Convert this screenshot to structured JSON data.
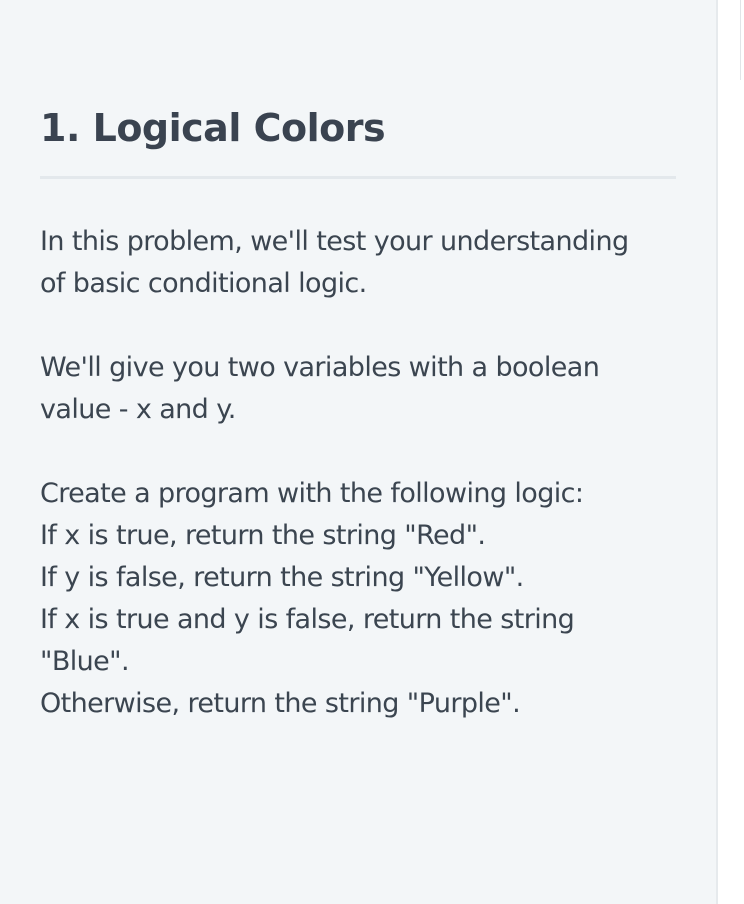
{
  "problem": {
    "title": "1. Logical Colors",
    "paragraph1": [
      "In this problem, we'll test your understanding",
      "of basic conditional logic."
    ],
    "paragraph2": [
      "We'll give you two variables with a boolean",
      "value - x and y."
    ],
    "paragraph3": [
      "Create a program with the following logic:",
      "If x is true, return the string \"Red\".",
      "If y is false, return the string \"Yellow\".",
      "If x is true and y is false, return the string",
      "\"Blue\".",
      "Otherwise, return the string \"Purple\"."
    ]
  },
  "colors": {
    "background": "#f3f6f8",
    "text": "#3b4550",
    "title": "#3a4350",
    "rule": "#e3e8ec"
  }
}
